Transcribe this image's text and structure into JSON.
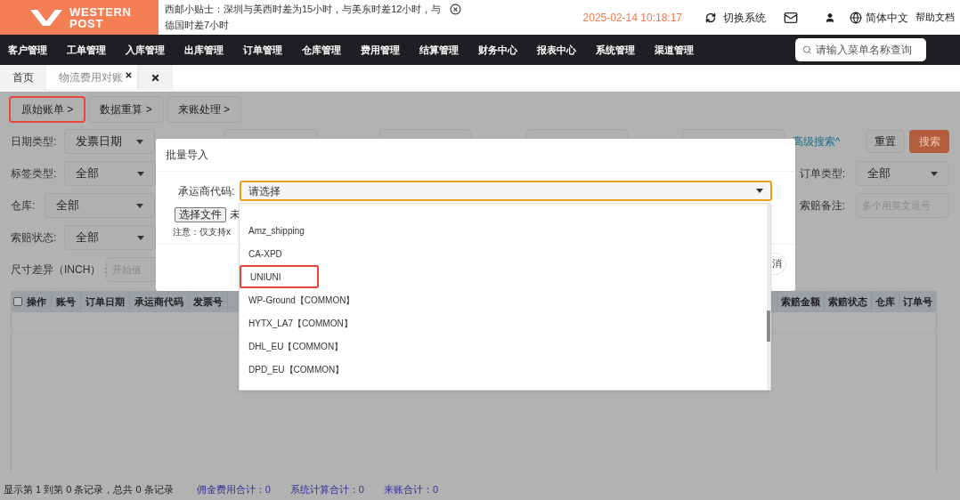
{
  "header": {
    "logo": {
      "line1": "WESTERN",
      "line2": "POST"
    },
    "tip": "西邮小贴士：深圳与美西时差为15小时，与美东时差12小时，与德国时差7小时",
    "datetime": "2025-02-14 10:18:17",
    "actions": [
      {
        "kind": "switch",
        "label": "切换系统"
      },
      {
        "kind": "mail"
      },
      {
        "kind": "user"
      },
      {
        "kind": "language",
        "label": "简体中文"
      },
      {
        "kind": "help",
        "label": "帮助文档"
      }
    ]
  },
  "nav": {
    "items": [
      "客户管理",
      "工单管理",
      "入库管理",
      "出库管理",
      "订单管理",
      "仓库管理",
      "费用管理",
      "结算管理",
      "财务中心",
      "报表中心",
      "系统管理",
      "渠道管理"
    ],
    "search": {
      "placeholder": "请输入菜单名称查询"
    }
  },
  "tabs": [
    {
      "kind": "text",
      "label": "首页",
      "selected": false,
      "closable": false
    },
    {
      "kind": "text",
      "label": "物流费用对账",
      "selected": true,
      "closable": true
    },
    {
      "kind": "close-all",
      "selected": false
    }
  ],
  "steps": [
    {
      "label": "原始账单 >",
      "highlighted": true
    },
    {
      "label": "数据重算 >",
      "highlighted": false
    },
    {
      "label": "来账处理 >",
      "highlighted": false
    }
  ],
  "filters": {
    "left": [
      {
        "kind": "select",
        "label": "日期类型:",
        "value": "发票日期"
      },
      {
        "kind": "select",
        "label": "标签类型:",
        "value": "全部"
      },
      {
        "kind": "select",
        "label": "仓库:",
        "value": "全部"
      },
      {
        "kind": "select",
        "label": "索赔状态:",
        "value": "全部"
      },
      {
        "kind": "input",
        "label": "尺寸差异（INCH）：",
        "placeholder": "开始值"
      }
    ],
    "advanced_search": "高级搜索^",
    "reset": "重置",
    "search": "搜索",
    "right": [
      {
        "kind": "select",
        "label": "订单类型:",
        "value": "全部"
      },
      {
        "kind": "input",
        "label": "索赔备注:",
        "placeholder": "多个用英文逗号"
      }
    ]
  },
  "table": {
    "select_all_checked": false,
    "columns_left": [
      "操作",
      "账号",
      "订单日期",
      "承运商代码",
      "发票号"
    ],
    "columns_right": [
      "索赔金额",
      "索赔状态",
      "仓库",
      "订单号"
    ]
  },
  "footer": {
    "summary": "显示第 1 到第 0 条记录，总共 0 条记录",
    "totals": [
      "佣金费用合计：0",
      "系统计算合计：0",
      "来账合计：0"
    ]
  },
  "modal": {
    "title": "批量导入",
    "carrier_label": "承运商代码:",
    "carrier_placeholder": "请选择",
    "file_button": "选择文件",
    "file_status": "未",
    "note": "注意：仅支持x",
    "cancel": "消",
    "options": [
      {
        "label": "Amz_shipping",
        "highlighted": false
      },
      {
        "label": "CA-XPD",
        "highlighted": false
      },
      {
        "label": "UNIUNI",
        "highlighted": true
      },
      {
        "label": "WP-Ground【COMMON】",
        "highlighted": false
      },
      {
        "label": "HYTX_LA7【COMMON】",
        "highlighted": false
      },
      {
        "label": "DHL_EU【COMMON】",
        "highlighted": false
      },
      {
        "label": "DPD_EU【COMMON】",
        "highlighted": false
      }
    ]
  }
}
